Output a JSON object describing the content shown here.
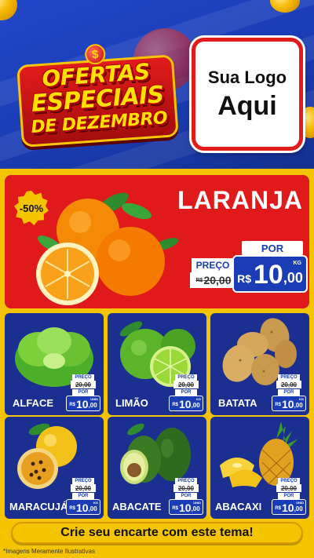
{
  "header": {
    "title_lines": [
      "OFERTAS",
      "ESPECIAIS",
      "DE DEZEMBRO"
    ],
    "dollar_symbol": "$",
    "logo_line1": "Sua Logo",
    "logo_line2": "Aqui"
  },
  "featured": {
    "discount": "-50%",
    "name": "LARANJA",
    "por_label": "POR",
    "preco_label": "PREÇO",
    "old_currency": "R$",
    "old_price": "20,00",
    "currency": "R$",
    "price_int": "10",
    "price_dec": ",00",
    "unit": "KG"
  },
  "products": [
    {
      "name": "ALFACE",
      "preco_label": "PREÇO",
      "old_price": "20,00",
      "por_label": "POR",
      "currency": "R$",
      "price_int": "10",
      "price_dec": ",00",
      "unit": "UNID"
    },
    {
      "name": "LIMÃO",
      "preco_label": "PREÇO",
      "old_price": "20,00",
      "por_label": "POR",
      "currency": "R$",
      "price_int": "10",
      "price_dec": ",00",
      "unit": "KG"
    },
    {
      "name": "BATATA",
      "preco_label": "PREÇO",
      "old_price": "20,00",
      "por_label": "POR",
      "currency": "R$",
      "price_int": "10",
      "price_dec": ",00",
      "unit": "KG"
    },
    {
      "name": "MARACUJÁ",
      "preco_label": "PREÇO",
      "old_price": "20,00",
      "por_label": "POR",
      "currency": "R$",
      "price_int": "10",
      "price_dec": ",00",
      "unit": "KG"
    },
    {
      "name": "ABACATE",
      "preco_label": "PREÇO",
      "old_price": "20,00",
      "por_label": "POR",
      "currency": "R$",
      "price_int": "10",
      "price_dec": ",00",
      "unit": "UNID"
    },
    {
      "name": "ABACAXI",
      "preco_label": "PREÇO",
      "old_price": "20,00",
      "por_label": "POR",
      "currency": "R$",
      "price_int": "10",
      "price_dec": ",00",
      "unit": "UNID"
    }
  ],
  "cta": "Crie seu encarte com este tema!",
  "disclaimer": "*Imagens Meramente Ilustrativas",
  "colors": {
    "red": "#e01a1a",
    "blue": "#1a2f8f",
    "yellow": "#f5c400",
    "header_blue": "#2147c9"
  }
}
